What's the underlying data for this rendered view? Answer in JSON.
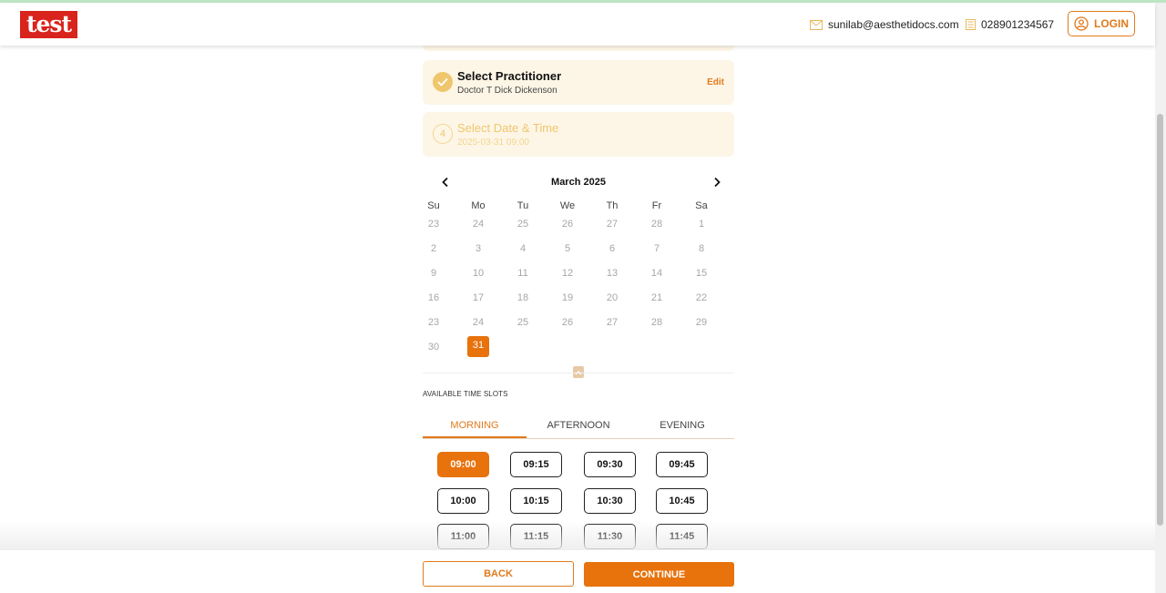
{
  "header": {
    "logo_text": "test",
    "email": "sunilab@aesthetidocs.com",
    "phone": "028901234567",
    "login_label": "LOGIN"
  },
  "steps": [
    {
      "title": "Select Practitioner",
      "subtitle": "Doctor T Dick Dickenson",
      "status": "completed",
      "edit_label": "Edit"
    },
    {
      "number": "4",
      "title": "Select Date & Time",
      "subtitle": "2025-03-31 09:00",
      "status": "active"
    }
  ],
  "calendar": {
    "month": "March 2025",
    "weekdays": [
      "Su",
      "Mo",
      "Tu",
      "We",
      "Th",
      "Fr",
      "Sa"
    ],
    "weeks": [
      [
        "23",
        "24",
        "25",
        "26",
        "27",
        "28",
        "1"
      ],
      [
        "2",
        "3",
        "4",
        "5",
        "6",
        "7",
        "8"
      ],
      [
        "9",
        "10",
        "11",
        "12",
        "13",
        "14",
        "15"
      ],
      [
        "16",
        "17",
        "18",
        "19",
        "20",
        "21",
        "22"
      ],
      [
        "23",
        "24",
        "25",
        "26",
        "27",
        "28",
        "29"
      ],
      [
        "30",
        "31",
        "",
        "",
        "",
        "",
        ""
      ]
    ],
    "selected_day": "31"
  },
  "time_slots": {
    "label": "AVAILABLE TIME SLOTS",
    "tabs": [
      "MORNING",
      "AFTERNOON",
      "EVENING"
    ],
    "active_tab": "MORNING",
    "slots": [
      "09:00",
      "09:15",
      "09:30",
      "09:45",
      "10:00",
      "10:15",
      "10:30",
      "10:45",
      "11:00",
      "11:15",
      "11:30",
      "11:45"
    ],
    "selected_slot": "09:00"
  },
  "footer": {
    "back_label": "BACK",
    "continue_label": "CONTINUE"
  },
  "colors": {
    "accent": "#e8720c",
    "card_bg": "#fdf6e7",
    "logo_red": "#d9231d"
  }
}
